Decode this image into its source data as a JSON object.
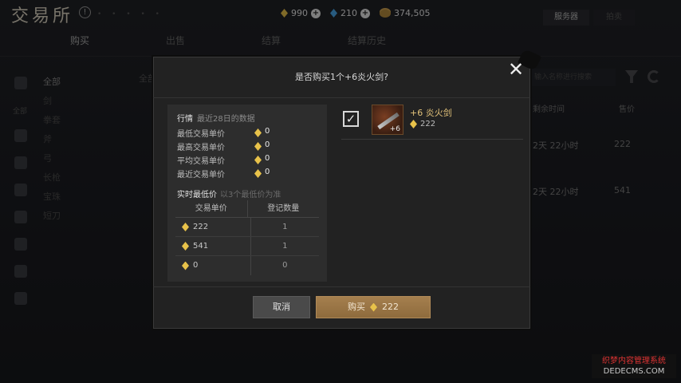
{
  "app": {
    "logo": "交易所",
    "info_icon": "exclamation-icon"
  },
  "currencies": [
    {
      "icon": "gold-diamond-icon",
      "value": "990",
      "add": true
    },
    {
      "icon": "blue-diamond-icon",
      "value": "210",
      "add": true
    },
    {
      "icon": "silver-coin-icon",
      "value": "374,505",
      "add": false
    }
  ],
  "header_buttons": {
    "server": "服务器",
    "other": "拍卖"
  },
  "tabs": [
    "购买",
    "出售",
    "结算",
    "结算历史"
  ],
  "categories": [
    "全部",
    "剑",
    "拳套",
    "斧",
    "弓",
    "长枪",
    "宝珠",
    "短刀"
  ],
  "sidebar": {
    "all_label": "全部"
  },
  "list_header_all": "全部",
  "search": {
    "placeholder": "输入名称进行搜索"
  },
  "columns": {
    "time": "剩余时间",
    "price": "售价"
  },
  "rows": [
    {
      "time": "2天 22小时",
      "price": "222"
    },
    {
      "time": "2天 22小时",
      "price": "541"
    }
  ],
  "modal": {
    "title": "是否购买1个+6炎火剑?",
    "market": {
      "heading": "行情",
      "subheading": "最近28日的数据",
      "stats": [
        {
          "label": "最低交易单价",
          "value": "0"
        },
        {
          "label": "最高交易单价",
          "value": "0"
        },
        {
          "label": "平均交易单价",
          "value": "0"
        },
        {
          "label": "最近交易单价",
          "value": "0"
        }
      ],
      "realtime_heading": "实时最低价",
      "realtime_sub": "以3个最低价为准",
      "table_headers": [
        "交易单价",
        "登记数量"
      ],
      "table_rows": [
        {
          "price": "222",
          "qty": "1"
        },
        {
          "price": "541",
          "qty": "1"
        },
        {
          "price": "0",
          "qty": "0"
        }
      ]
    },
    "item": {
      "name": "+6 炎火剑",
      "price": "222",
      "enhance": "+6",
      "checked": true
    },
    "cancel_label": "取消",
    "buy_label": "购买",
    "buy_price": "222"
  },
  "watermark": {
    "line1": "织梦内容管理系统",
    "line2": "DEDECMS.COM"
  },
  "colors": {
    "gold": "#e8c24a",
    "accent_button": "#9c7847",
    "item_name": "#e2c27a"
  }
}
